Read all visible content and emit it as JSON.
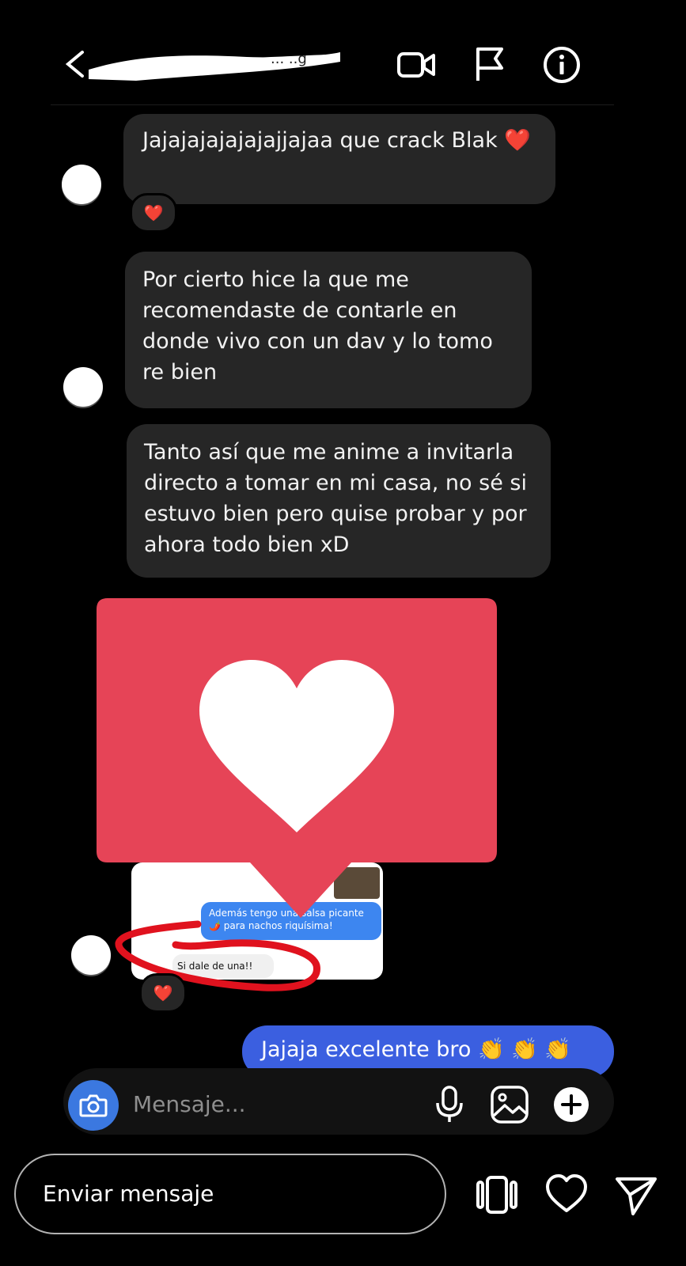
{
  "header": {
    "icons": {
      "back": "chevron-left-icon",
      "video": "video-camera-icon",
      "report": "flag-icon",
      "info": "info-icon"
    }
  },
  "messages": [
    {
      "text": "Jajajajajajajajjajaa que crack Blak ❤️",
      "reaction": "❤️"
    },
    {
      "text": "Por cierto hice la que me recomendaste de contarle en donde vivo con un dav y lo tomo re bien"
    },
    {
      "text": "Tanto así que me anime a invitarla directo a tomar en mi casa, no sé si estuvo bien pero quise probar y por ahora todo bien xD"
    }
  ],
  "shared_screenshot": {
    "bubble_text": "Además tengo una salsa picante 🌶️ para nachos riquísima!",
    "reply_text": "Si dale de una!!",
    "reaction": "❤️"
  },
  "outgoing": {
    "text": "Jajaja excelente bro 👏 👏 👏"
  },
  "composer": {
    "placeholder": "Mensaje...",
    "icons": [
      "camera-icon",
      "microphone-icon",
      "gallery-icon",
      "plus-icon"
    ]
  },
  "story_bar": {
    "placeholder": "Enviar mensaje",
    "icons": [
      "story-frames-icon",
      "heart-icon",
      "send-icon"
    ]
  },
  "colors": {
    "background": "#000000",
    "bubble_in": "#262626",
    "bubble_out": "#3b5fe0",
    "like_sticker": "#e64457",
    "highlight_circle": "#e0121e"
  }
}
